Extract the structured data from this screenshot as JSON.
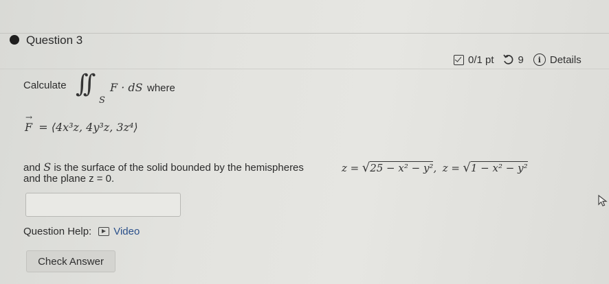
{
  "question": {
    "title": "Question 3",
    "score": "0/1 pt",
    "retries": "9",
    "details": "Details"
  },
  "problem": {
    "calculate": "Calculate",
    "integrand": "F · dS",
    "subscript": "S",
    "where": "where",
    "field_lhs": "F",
    "field_rhs": "= ⟨4x³z, 4y³z, 3z⁴⟩",
    "and": "and",
    "S": "S",
    "line1_text": "is the surface of the solid bounded by the hemispheres",
    "hemi1_lhs": "z =",
    "hemi1_rad": "25 − x² − y²",
    "comma": ",",
    "hemi2_lhs": "z =",
    "hemi2_rad": "1 − x² − y²",
    "line2": "and the plane z = 0."
  },
  "answer": {
    "value": ""
  },
  "help": {
    "label": "Question Help:",
    "video": "Video"
  },
  "actions": {
    "check": "Check Answer"
  },
  "icons": [
    "bullet-icon",
    "score-icon",
    "retry-icon",
    "info-icon",
    "video-icon",
    "cursor-icon"
  ]
}
